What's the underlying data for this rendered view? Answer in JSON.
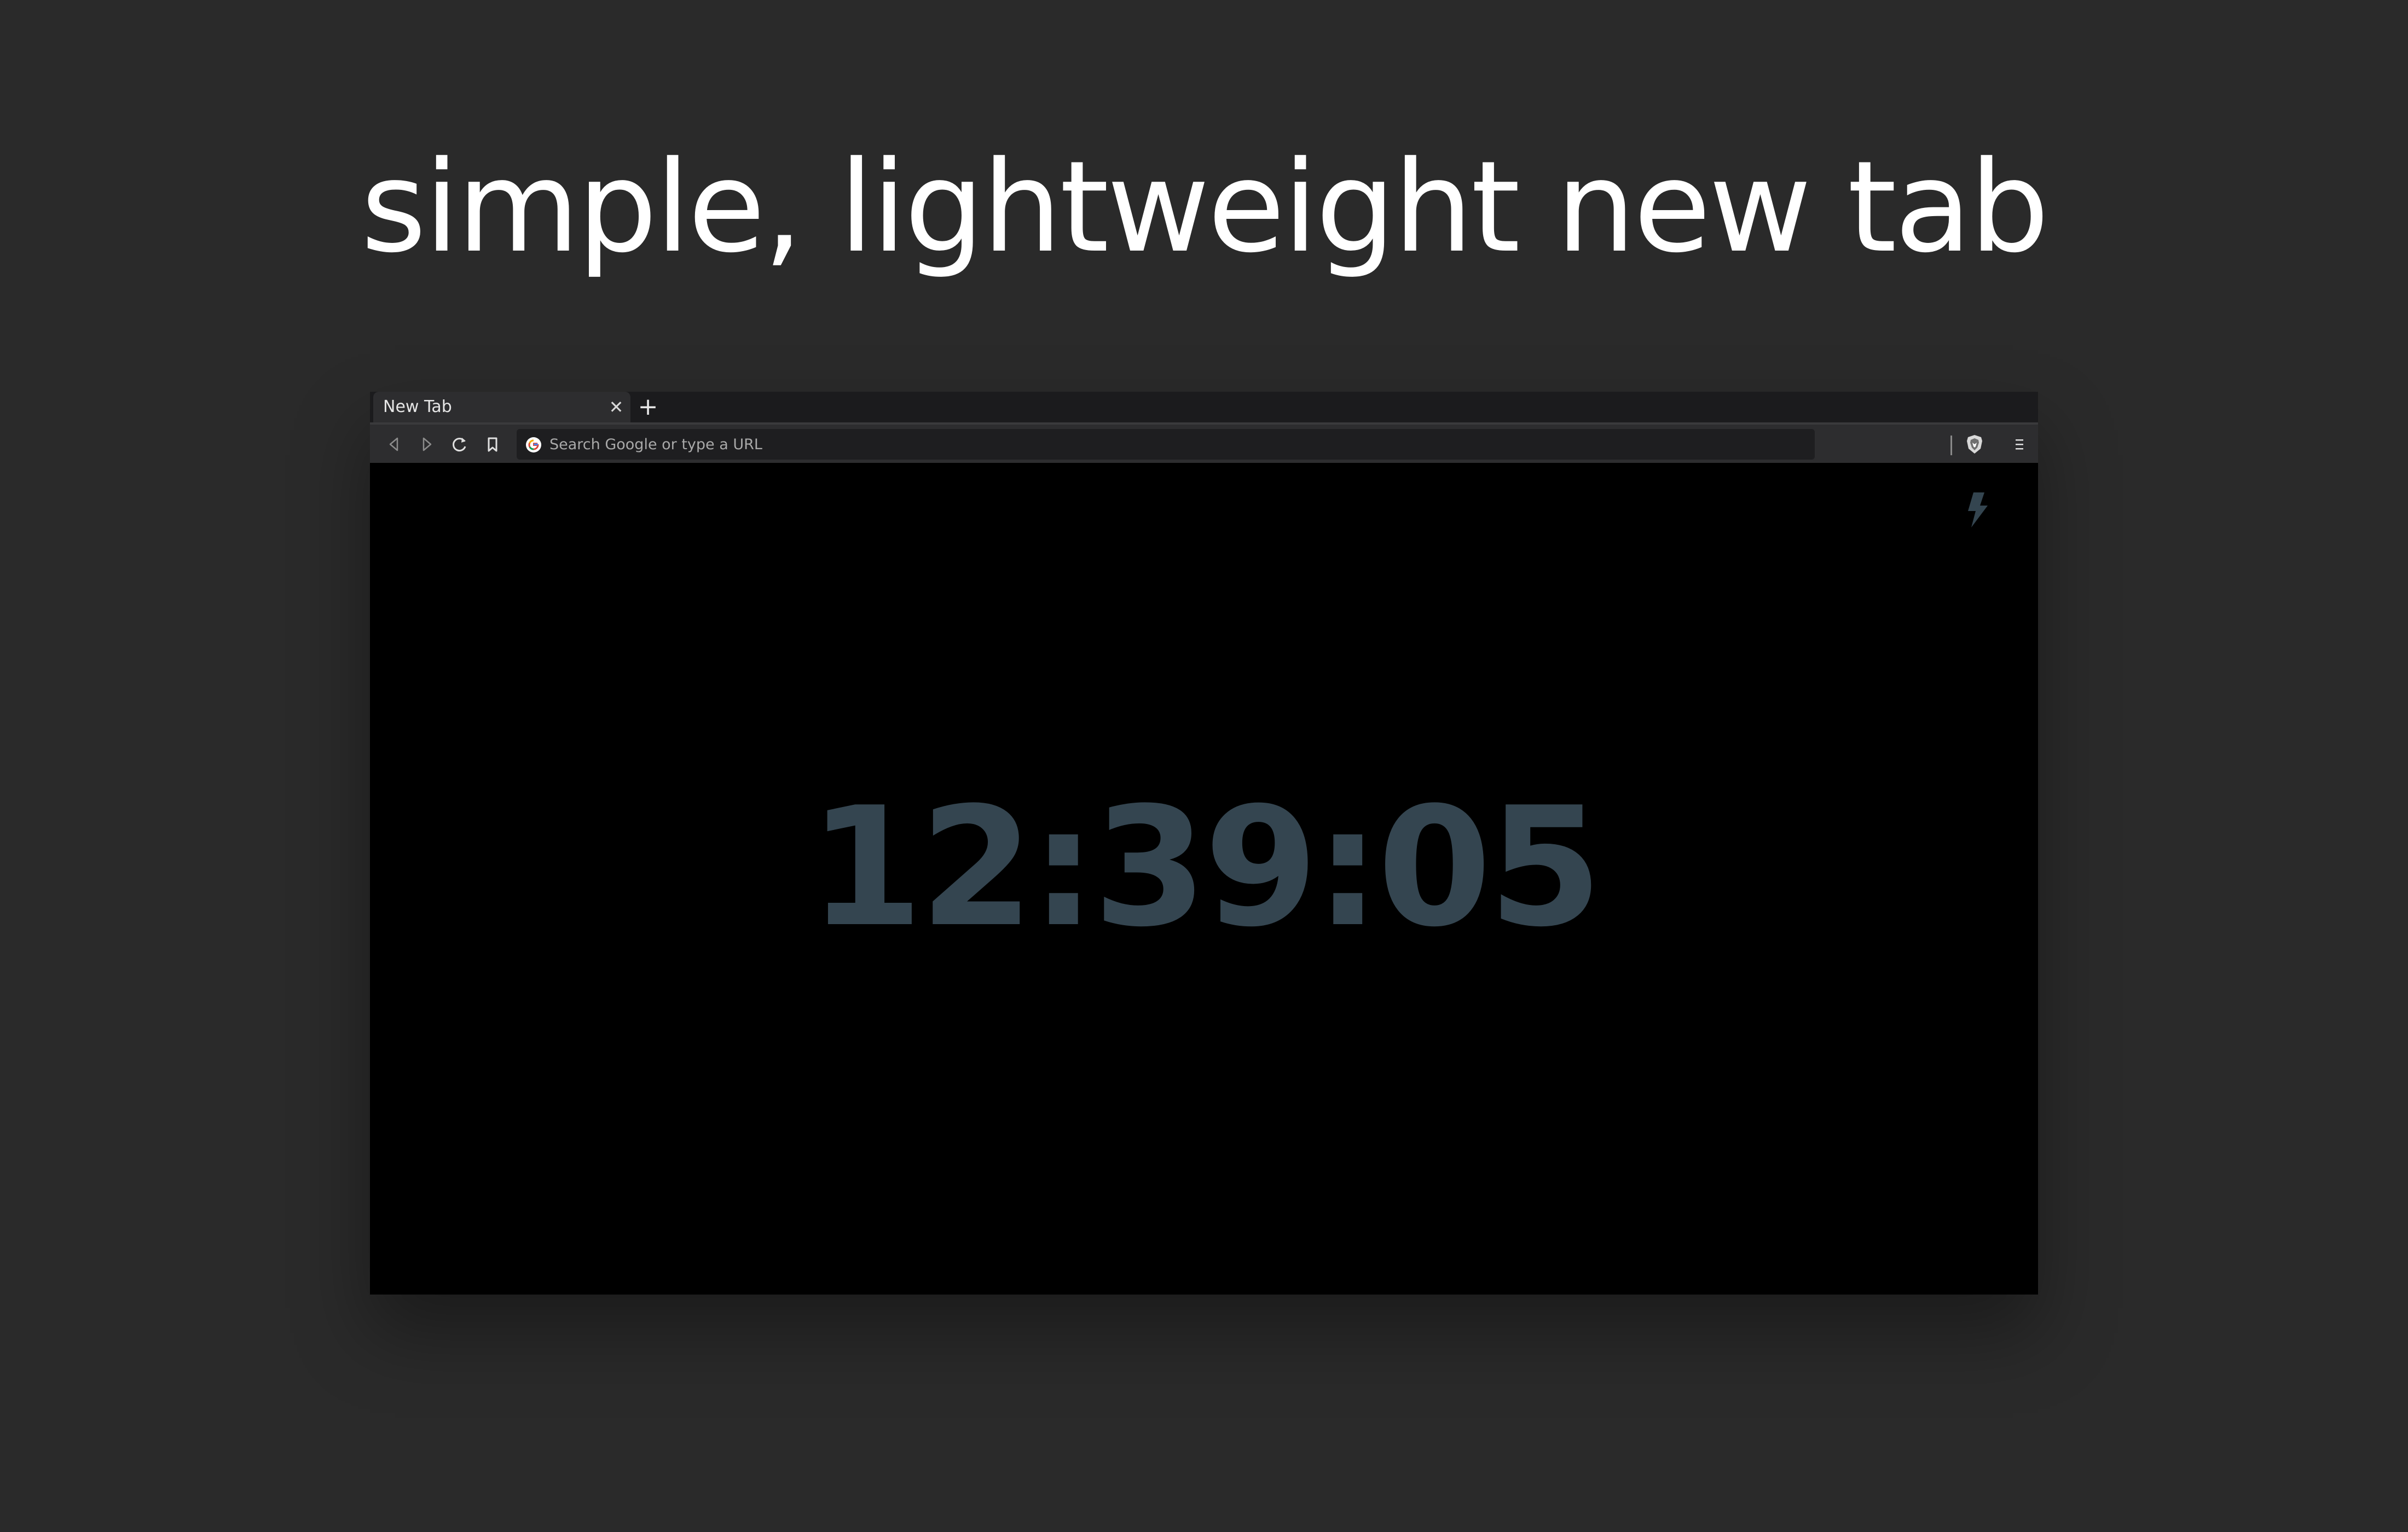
{
  "headline": "simple, lightweight new tab",
  "browser": {
    "tab": {
      "title": "New Tab",
      "close_glyph": "✕",
      "new_tab_glyph": "+"
    },
    "toolbar": {
      "back_icon": "back-arrow-icon",
      "forward_icon": "forward-arrow-icon",
      "reload_icon": "reload-icon",
      "bookmark_icon": "bookmark-icon",
      "menu_icon": "hamburger-menu-icon"
    },
    "omnibox": {
      "placeholder": "Search Google or type a URL",
      "value": "",
      "search_engine_icon": "google-icon",
      "shield_icon": "brave-shield-icon"
    }
  },
  "page": {
    "time": "12:39:05",
    "clock_color": "#344550",
    "corner_icon": "lightning-bolt-icon",
    "background": "#000000"
  }
}
